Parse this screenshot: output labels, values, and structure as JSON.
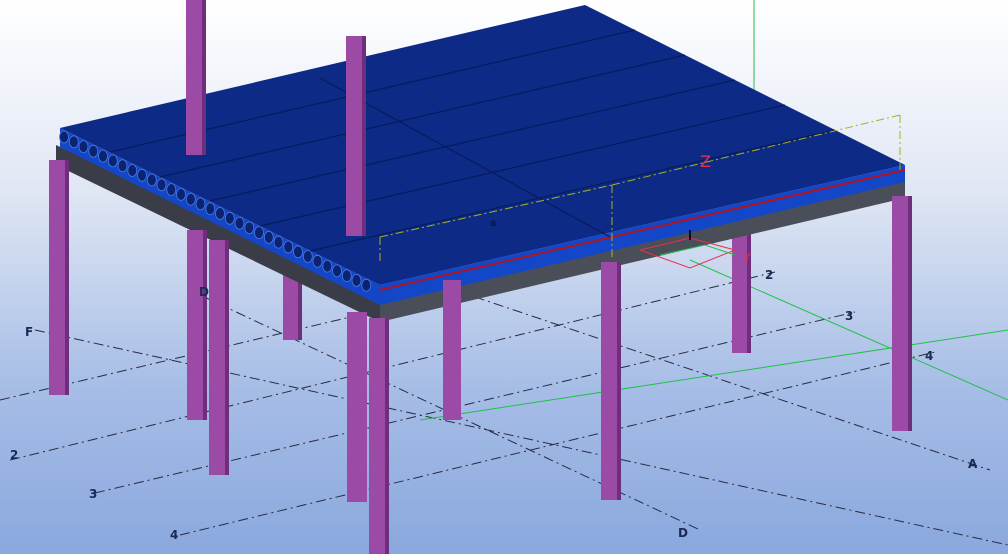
{
  "window": {
    "title": ""
  },
  "view": {
    "type": "3d-model-view",
    "background_top": "#ffffff",
    "background_bottom": "#8aa8de"
  },
  "colors": {
    "slab": "#0c2a86",
    "slab_side": "#1446c8",
    "slab_dark": "#071c5c",
    "beam": "#3a3d47",
    "column": "#9b4aa6",
    "column_dark": "#6f2e7c",
    "gridline": "#2a2a40",
    "red_edge": "#b0141e",
    "axis": "#e0344c",
    "green_guide": "#22c04a",
    "work_area": "#a8b020"
  },
  "grid_labels": [
    {
      "id": "F",
      "text": "F"
    },
    {
      "id": "D1",
      "text": "D"
    },
    {
      "id": "D2",
      "text": "D"
    },
    {
      "id": "A",
      "text": "A"
    },
    {
      "id": "L2a",
      "text": "2"
    },
    {
      "id": "L3a",
      "text": "3"
    },
    {
      "id": "L4a",
      "text": "4"
    },
    {
      "id": "L2b",
      "text": "2"
    },
    {
      "id": "L3b",
      "text": "3"
    },
    {
      "id": "L4b",
      "text": "4"
    }
  ],
  "axes": {
    "z": "Z",
    "y": "Y"
  },
  "marks": {
    "a": "a"
  }
}
